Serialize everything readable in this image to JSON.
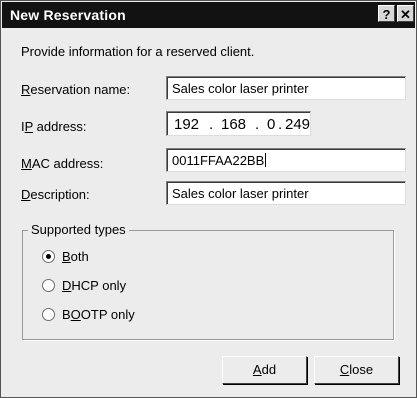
{
  "window": {
    "title": "New Reservation",
    "help_label": "?",
    "close_label": "✕"
  },
  "intro": "Provide information for a reserved client.",
  "fields": {
    "reservation_name": {
      "label_u": "R",
      "label_rest": "eservation name:",
      "value": "Sales color laser printer"
    },
    "ip_address": {
      "label_pre": "I",
      "label_u": "P",
      "label_rest": " address:",
      "octets": [
        "192",
        "168",
        "0",
        "249"
      ]
    },
    "mac_address": {
      "label_u": "M",
      "label_rest": "AC address:",
      "value": "0011FFAA22BB"
    },
    "description": {
      "label_u": "D",
      "label_rest": "escription:",
      "value": "Sales color laser printer"
    }
  },
  "supported_types": {
    "label": "Supported types",
    "options": [
      {
        "label_u": "B",
        "label_rest": "oth",
        "selected": true
      },
      {
        "label_u": "D",
        "label_rest": "HCP only",
        "selected": false
      },
      {
        "label_pre": "B",
        "label_u": "O",
        "label_rest": "OTP only",
        "selected": false
      }
    ]
  },
  "buttons": {
    "add": {
      "label_u": "A",
      "label_rest": "dd"
    },
    "close": {
      "label_u": "C",
      "label_rest": "lose"
    }
  }
}
